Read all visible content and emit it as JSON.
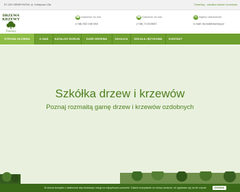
{
  "topbar": {
    "address": "57-220 HENRYKÓW, ul. Kolejowa 13a",
    "tagline": "Trawnicy - szkółka drzew i krzewów"
  },
  "header": {
    "logo": {
      "line1": "DRZEWA",
      "line2": "KRZEWY",
      "line3": "Trawnicy"
    },
    "contacts": [
      {
        "icon": "phone-icon",
        "label": "Zadzwoń do nas",
        "value": "(+48) 502 048 083"
      },
      {
        "icon": "phone-icon",
        "label": "Zadzwoń do nas",
        "value": "(+48) 74 815520"
      },
      {
        "icon": "mail-icon",
        "label": "Napisz wiadomość",
        "value": "e-mail: biuro@trawnicy.pl"
      }
    ]
  },
  "nav": {
    "items": [
      {
        "label": "STRONA GŁÓWNA",
        "active": true
      },
      {
        "label": "O NAS"
      },
      {
        "label": "KATALOG ROŚLIN"
      },
      {
        "label": "DUŻE DRZEWA"
      },
      {
        "label": "OKOLICA"
      },
      {
        "label": "SZKOŁA JĘZYKOWA"
      },
      {
        "label": "KONTAKT"
      }
    ]
  },
  "hero": {
    "title": "Szkółka drzew i krzewów",
    "subtitle": "Poznaj rozmaitą gamę drzew i krzewów ozdobnych"
  },
  "cookie": {
    "message": "Ta strona korzysta z ciasteczek aby świadczyć usługi na najwyższym poziomie. Dalsze korzystanie ze strony oznacza, że zgadzasz się na ich użycie.",
    "button": "ZGODA"
  },
  "colors": {
    "brand": "#6d9f2e",
    "hero_bg": "#e9f1de",
    "cookie_bg": "#3a6a17"
  }
}
